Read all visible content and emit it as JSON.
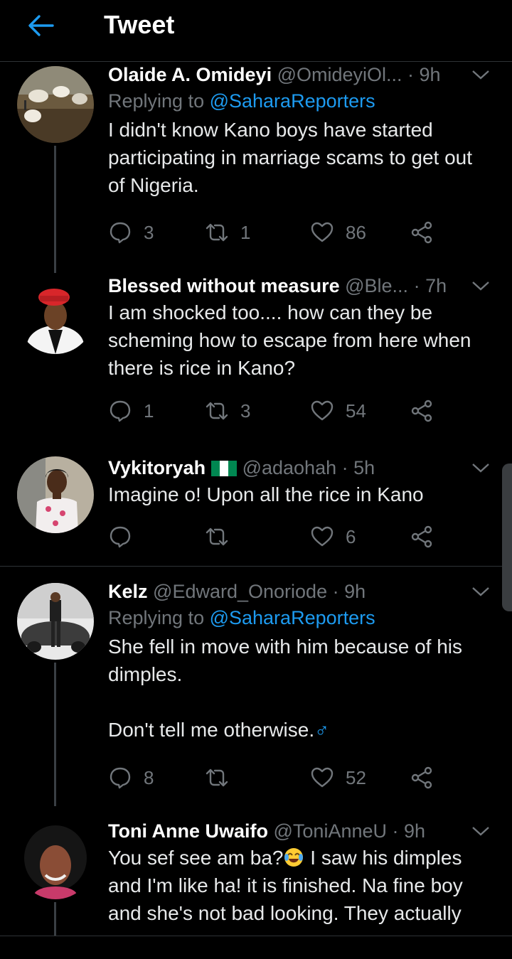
{
  "header": {
    "title": "Tweet"
  },
  "tweets": [
    {
      "name": "Olaide A. Omideyi",
      "handle": "@OmideyiOl...",
      "time": "9h",
      "replying_prefix": "Replying to ",
      "replying_to": "@SaharaReporters",
      "text": "I didn't know Kano boys have started participating in marriage scams to get out of Nigeria.",
      "replies": "3",
      "retweets": "1",
      "likes": "86"
    },
    {
      "name": "Blessed without measure",
      "handle": "@Ble...",
      "time": "7h",
      "text": "I am shocked too.... how can they be scheming how to escape from here when there is rice in Kano?",
      "replies": "1",
      "retweets": "3",
      "likes": "54"
    },
    {
      "name": "Vykitoryah",
      "handle": "@adaohah",
      "time": "5h",
      "text": "Imagine o! Upon all the rice in Kano",
      "replies": "",
      "retweets": "",
      "likes": "6"
    },
    {
      "name": "Kelz",
      "handle": "@Edward_Onoriode",
      "time": "9h",
      "replying_prefix": "Replying to ",
      "replying_to": "@SaharaReporters",
      "text_line1": "She fell in move with him because of his dimples.",
      "text_line2": "Don't tell me otherwise.",
      "text_line2_symbol": "♂",
      "replies": "8",
      "retweets": "",
      "likes": "52"
    },
    {
      "name": "Toni Anne Uwaifo",
      "handle": "@ToniAnneU",
      "time": "9h",
      "text_part1": "You sef see am ba?",
      "text_part2": " I saw his dimples and I'm like ha! it is finished. Na fine boy and she's not bad looking. They actually"
    }
  ],
  "separator": " · ",
  "colors": {
    "background": "#000000",
    "accent": "#1d9bf0",
    "muted": "#71767b",
    "text": "#e7e9ea",
    "divider": "#2f3336"
  },
  "icons": {
    "back": "arrow-left-icon",
    "menu": "chevron-down-icon",
    "reply": "speech-bubble-icon",
    "retweet": "retweet-icon",
    "like": "heart-icon",
    "share": "share-icon",
    "flag": "nigeria-flag-icon",
    "emoji": "tears-of-joy-emoji"
  }
}
